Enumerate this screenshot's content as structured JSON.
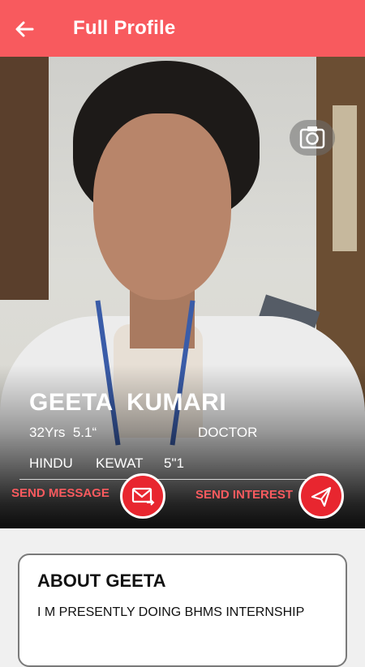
{
  "header": {
    "title": "Full Profile",
    "back_icon": "arrow-left-icon",
    "background_color": "#f85a5e"
  },
  "profile": {
    "photo_icon": "camera-icon",
    "name": "GEETA  KUMARI",
    "age_height": "32Yrs  5.1“",
    "occupation": "DOCTOR",
    "religion": "HINDU",
    "caste": "KEWAT",
    "height": "5\"1"
  },
  "actions": {
    "send_message_label": "SEND MESSAGE",
    "send_message_icon": "mail-send-icon",
    "send_interest_label": "SEND INTEREST",
    "send_interest_icon": "paper-plane-icon",
    "accent_color": "#e8262f"
  },
  "about": {
    "title": "ABOUT GEETA",
    "text": "I M PRESENTLY DOING BHMS INTERNSHIP"
  }
}
